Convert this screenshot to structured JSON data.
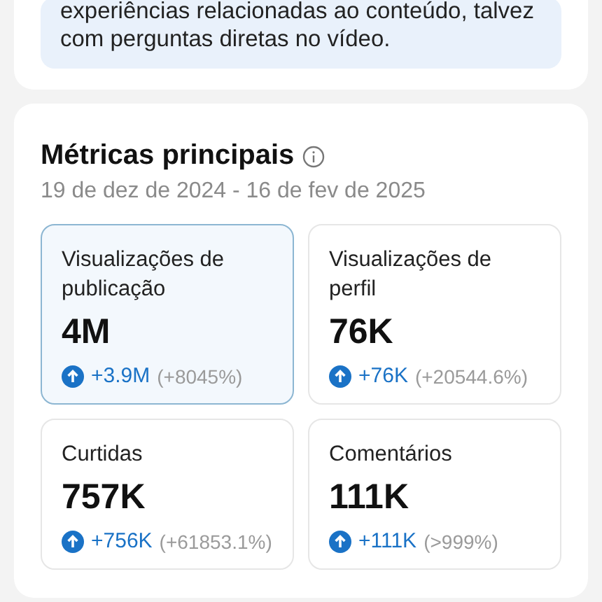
{
  "tip": {
    "text": "experiências relacionadas ao conteúdo, talvez com perguntas diretas no vídeo."
  },
  "metrics": {
    "title": "Métricas principais",
    "date_range": "19 de dez de 2024 - 16 de fev de 2025",
    "tiles": [
      {
        "label": "Visualizações de publicação",
        "value": "4M",
        "change": "+3.9M",
        "percent": "(+8045%)",
        "selected": true
      },
      {
        "label": "Visualizações de perfil",
        "value": "76K",
        "change": "+76K",
        "percent": "(+20544.6%)",
        "selected": false
      },
      {
        "label": "Curtidas",
        "value": "757K",
        "change": "+756K",
        "percent": "(+61853.1%)",
        "selected": false
      },
      {
        "label": "Comentários",
        "value": "111K",
        "change": "+111K",
        "percent": "(>999%)",
        "selected": false
      }
    ]
  }
}
